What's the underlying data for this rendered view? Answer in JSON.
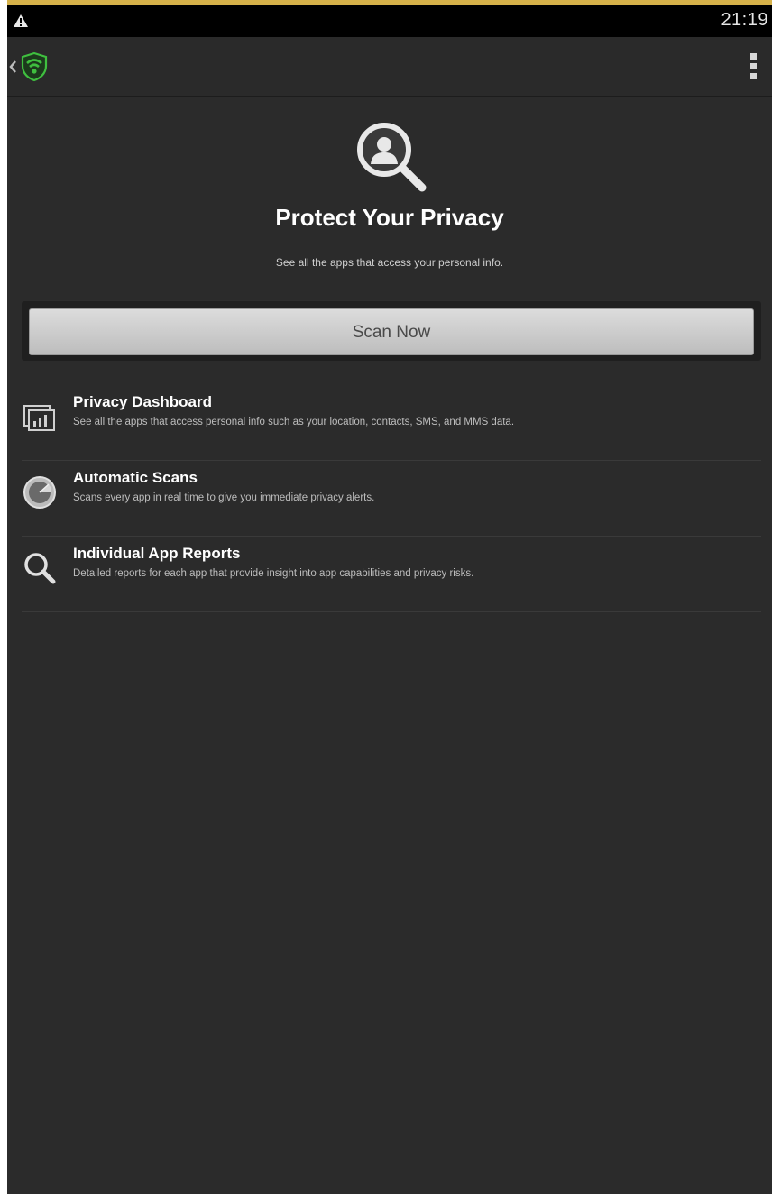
{
  "status_bar": {
    "time": "21:19",
    "warning_icon": "warning-triangle-icon"
  },
  "action_bar": {
    "back_icon": "chevron-left-icon",
    "logo_icon": "wifi-shield-logo-icon",
    "overflow_icon": "overflow-menu-icon"
  },
  "hero": {
    "icon": "privacy-search-icon",
    "title": "Protect Your Privacy",
    "subtitle": "See all the apps that access your personal info."
  },
  "scan_button": {
    "label": "Scan Now"
  },
  "features": [
    {
      "icon": "dashboard-chart-icon",
      "title": "Privacy Dashboard",
      "description": "See all the apps that access personal info such as your location, contacts, SMS, and MMS data."
    },
    {
      "icon": "radar-scan-icon",
      "title": "Automatic Scans",
      "description": "Scans every app in real time to give you immediate privacy alerts."
    },
    {
      "icon": "magnifier-icon",
      "title": "Individual App Reports",
      "description": "Detailed reports for each app that provide insight into app capabilities and privacy risks."
    }
  ],
  "colors": {
    "background": "#2b2b2b",
    "status_bar": "#000000",
    "top_accent": "#d6b24a",
    "logo_green": "#3fbf3f",
    "button": "#c9c9c9"
  }
}
